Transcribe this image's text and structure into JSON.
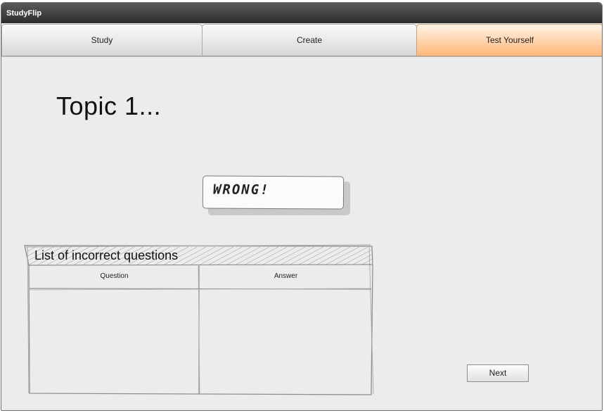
{
  "app": {
    "title": "StudyFlip"
  },
  "tabs": [
    {
      "label": "Study",
      "active": false
    },
    {
      "label": "Create",
      "active": false
    },
    {
      "label": "Test Yourself",
      "active": true
    }
  ],
  "main": {
    "topic_title": "Topic 1...",
    "feedback": "WRONG!",
    "incorrect_table": {
      "title": "List of incorrect questions",
      "columns": [
        "Question",
        "Answer"
      ],
      "rows": []
    },
    "next_label": "Next"
  },
  "colors": {
    "active_tab_top": "#fff3e6",
    "active_tab_bottom": "#ffb877",
    "titlebar": "#3a3a3a",
    "background": "#ececec"
  }
}
